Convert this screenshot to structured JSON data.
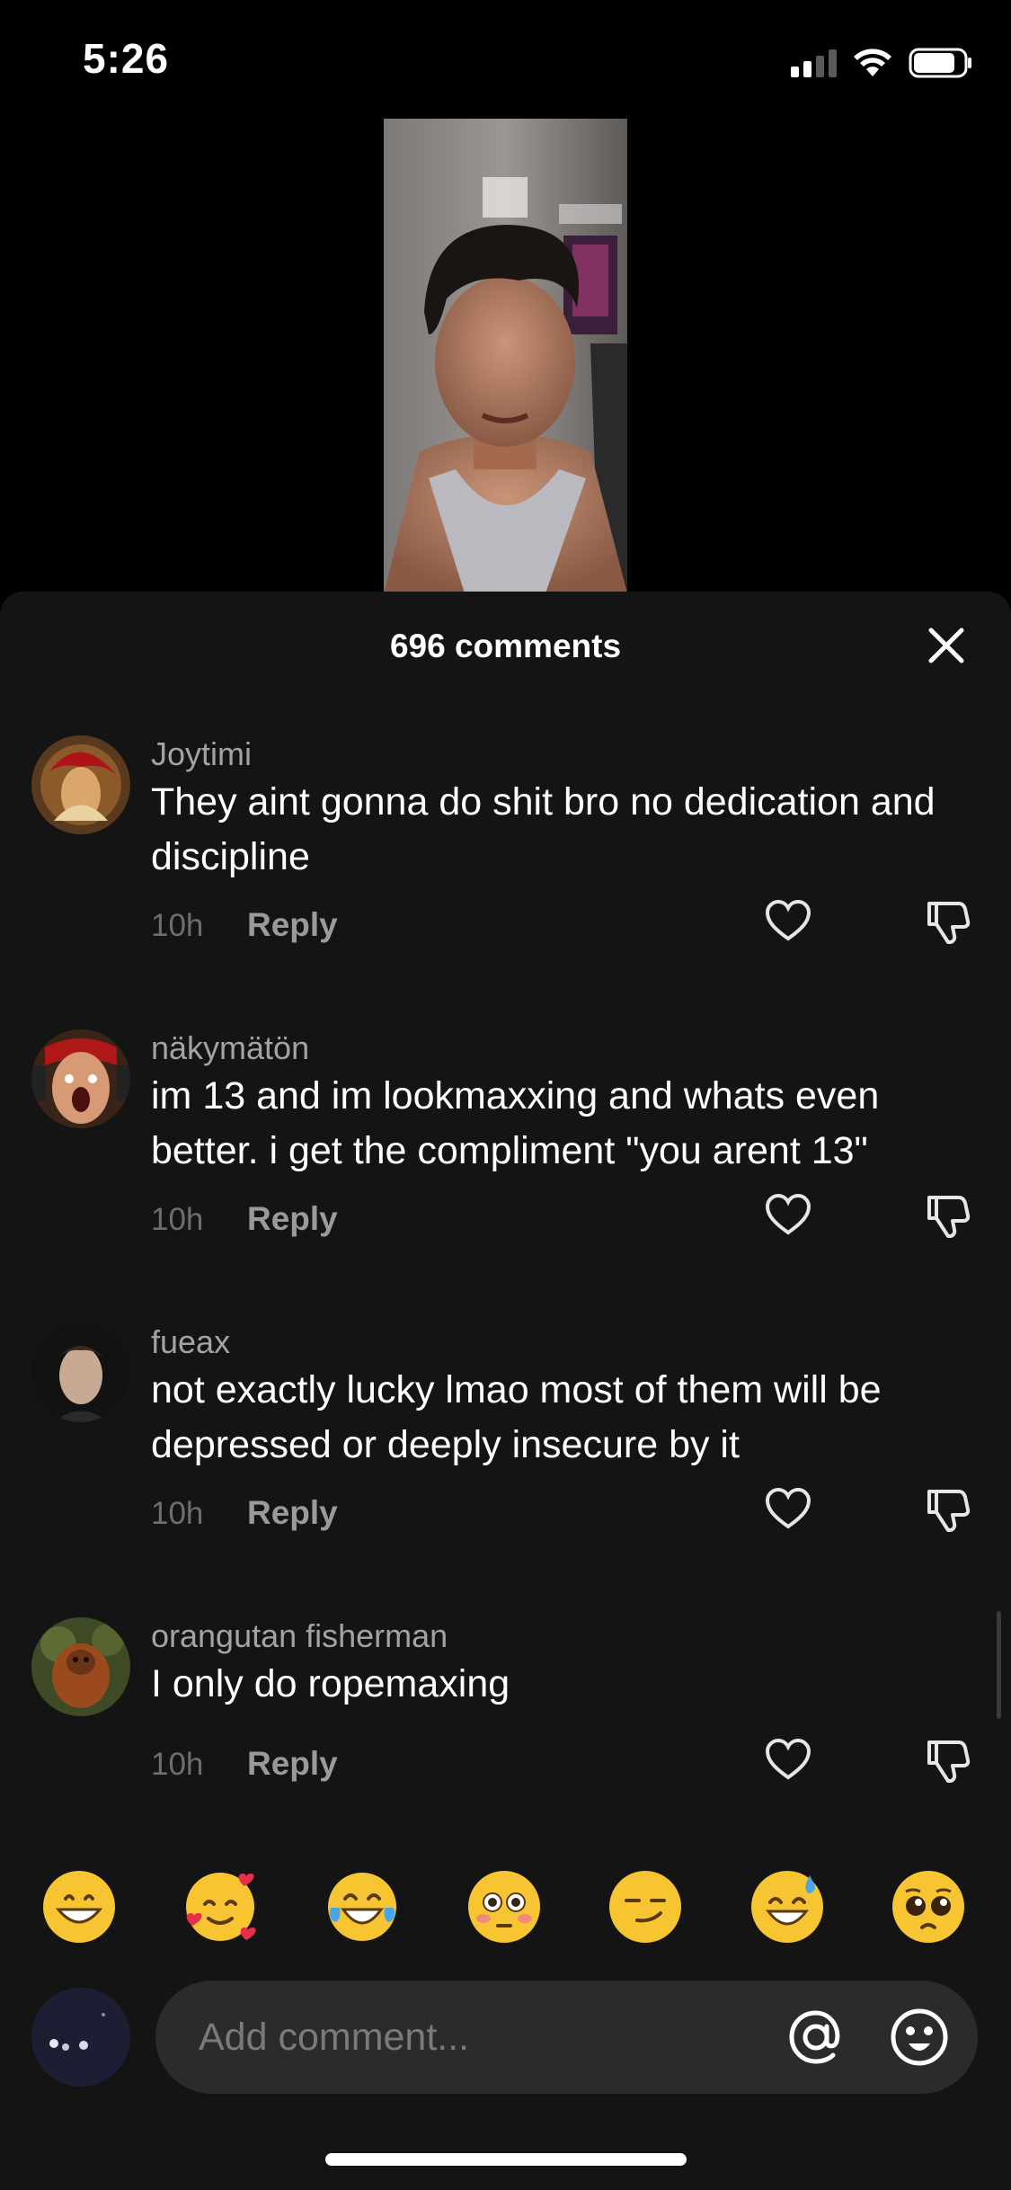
{
  "status_bar": {
    "time": "5:26",
    "battery_level": 0.8
  },
  "sheet": {
    "title": "696 comments"
  },
  "comments": [
    {
      "user": "Joytimi",
      "text": "They aint gonna do shit bro no dedication and discipline",
      "time": "10h",
      "reply_label": "Reply"
    },
    {
      "user": "näkymätön",
      "text": "im 13 and im lookmaxxing and whats even better. i get the compliment \"you arent 13\"",
      "time": "10h",
      "reply_label": "Reply"
    },
    {
      "user": "fueax",
      "text": "not exactly lucky lmao most of them will be depressed or deeply insecure by it",
      "time": "10h",
      "reply_label": "Reply"
    },
    {
      "user": "orangutan fisherman",
      "text": "I only do ropemaxing",
      "time": "10h",
      "reply_label": "Reply"
    }
  ],
  "emoji_bar": [
    "grinning-face",
    "smiling-face-with-hearts",
    "face-with-tears-of-joy",
    "flushed-face",
    "smirking-face",
    "grinning-face-with-sweat",
    "pleading-face"
  ],
  "input": {
    "placeholder": "Add comment..."
  },
  "colors": {
    "sheet_bg": "#141414",
    "input_bg": "#2b2b2b",
    "muted_text": "#a3a3a3",
    "emoji_yellow": "#f7c531"
  }
}
